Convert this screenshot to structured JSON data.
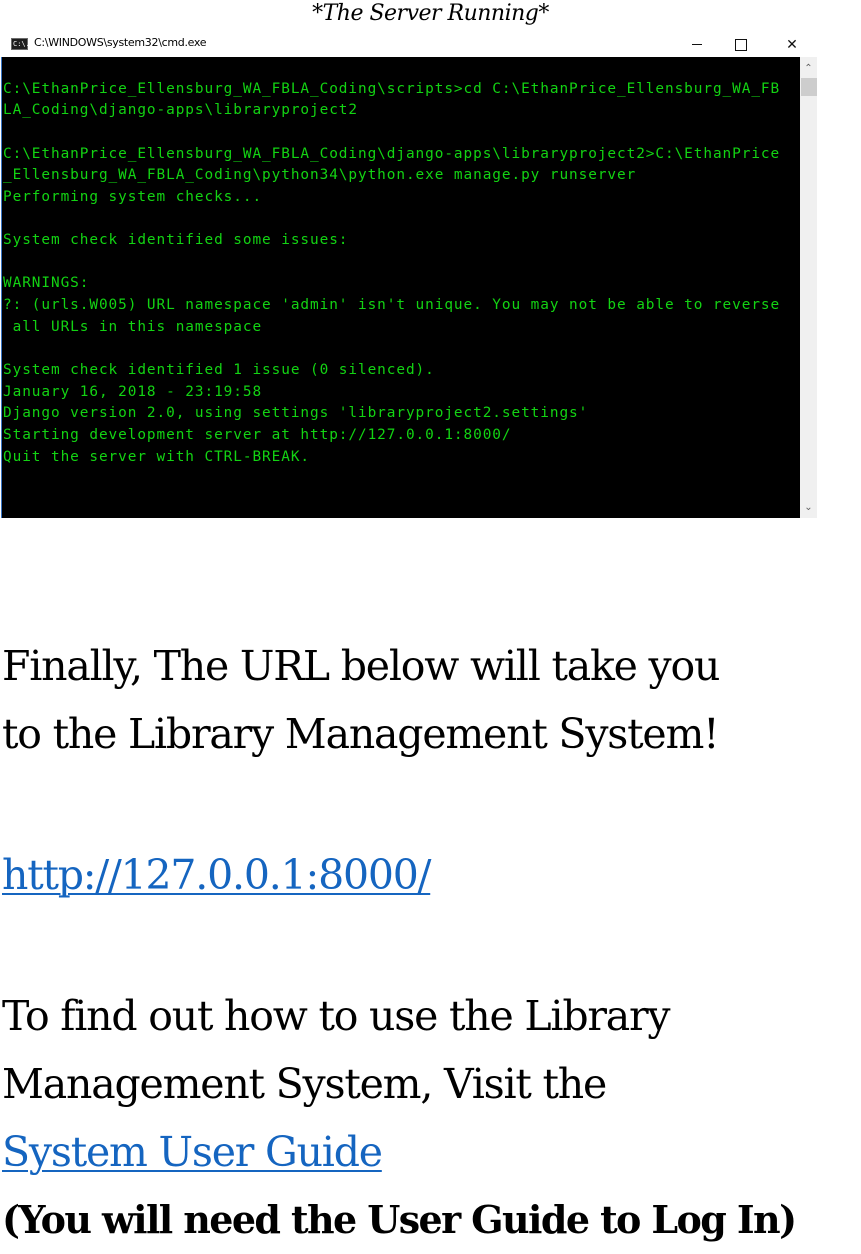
{
  "caption": "*The Server Running*",
  "window": {
    "title": "C:\\WINDOWS\\system32\\cmd.exe",
    "app_icon_label": "C:\\.",
    "controls": {
      "minimize": "minimize",
      "maximize": "maximize",
      "close": "✕"
    },
    "scrollbar": {
      "up_arrow": "⌃",
      "down_arrow": "⌄"
    },
    "console_lines": [
      "",
      "C:\\EthanPrice_Ellensburg_WA_FBLA_Coding\\scripts>cd C:\\EthanPrice_Ellensburg_WA_FB",
      "LA_Coding\\django-apps\\libraryproject2",
      "",
      "C:\\EthanPrice_Ellensburg_WA_FBLA_Coding\\django-apps\\libraryproject2>C:\\EthanPrice",
      "_Ellensburg_WA_FBLA_Coding\\python34\\python.exe manage.py runserver",
      "Performing system checks...",
      "",
      "System check identified some issues:",
      "",
      "WARNINGS:",
      "?: (urls.W005) URL namespace 'admin' isn't unique. You may not be able to reverse",
      " all URLs in this namespace",
      "",
      "System check identified 1 issue (0 silenced).",
      "January 16, 2018 - 23:19:58",
      "Django version 2.0, using settings 'libraryproject2.settings'",
      "Starting development server at http://127.0.0.1:8000/",
      "Quit the server with CTRL-BREAK.",
      ""
    ]
  },
  "document": {
    "intro_line_1": "Finally, The URL below will take you",
    "intro_line_2": "to the Library Management System!",
    "url_link": "http://127.0.0.1:8000/",
    "guide_line_1": "To find out how to use the Library",
    "guide_line_2": "Management System, Visit the",
    "guide_link": "System User Guide",
    "note": "(You will need the User Guide to Log In)"
  },
  "colors": {
    "console_text": "#13d313",
    "console_bg": "#000000",
    "link": "#1565c0"
  }
}
